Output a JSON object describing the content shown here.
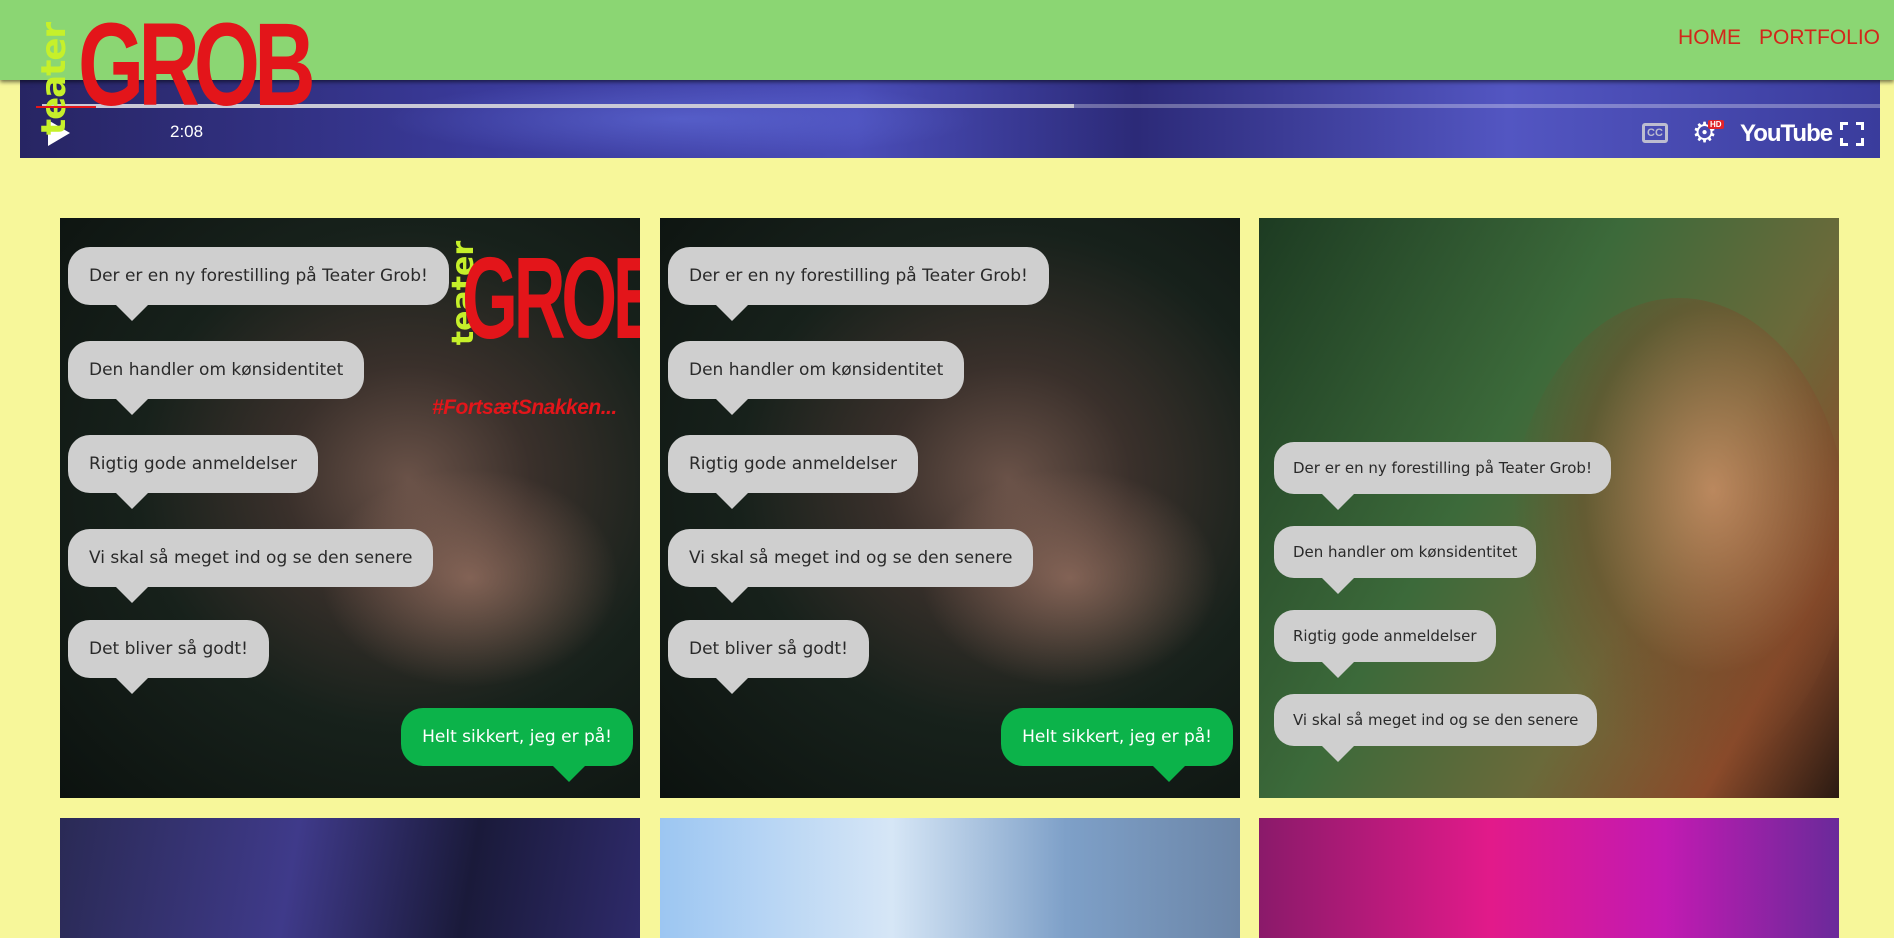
{
  "header": {
    "logo": {
      "word_small": "teater",
      "word_big": "GROB"
    },
    "nav": [
      {
        "label": "HOME"
      },
      {
        "label": "PORTFOLIO"
      }
    ]
  },
  "video": {
    "time": "2:08",
    "progress": 0.56,
    "controls": {
      "cc_label": "CC",
      "hd_label": "HD",
      "brand_label": "YouTube"
    }
  },
  "tiles": [
    {
      "poster": {
        "teater": "teater",
        "grob": "GROB",
        "hashtag": "#FortsætSnakken..."
      },
      "messages": [
        "Der er en ny forestilling på Teater Grob!",
        "Den handler om kønsidentitet",
        "Rigtig gode anmeldelser",
        "Vi skal så meget ind og se den senere",
        "Det bliver så godt!"
      ],
      "reply": "Helt sikkert, jeg er på!"
    },
    {
      "messages": [
        "Der er en ny forestilling på Teater Grob!",
        "Den handler om kønsidentitet",
        "Rigtig gode anmeldelser",
        "Vi skal så meget ind og se den senere",
        "Det bliver så godt!"
      ],
      "reply": "Helt sikkert, jeg er på!"
    },
    {
      "messages": [
        "Der er en ny forestilling på Teater Grob!",
        "Den handler om kønsidentitet",
        "Rigtig gode anmeldelser",
        "Vi skal så meget ind og se den senere"
      ]
    }
  ],
  "colors": {
    "page_bg": "#f7f79a",
    "header_bg": "#8bd673",
    "nav_text": "#d2271a",
    "bubble_gray": "#cfcfcf",
    "bubble_green": "#0cb34a",
    "logo_red": "#e3151a",
    "logo_lime": "#c6f02a"
  }
}
